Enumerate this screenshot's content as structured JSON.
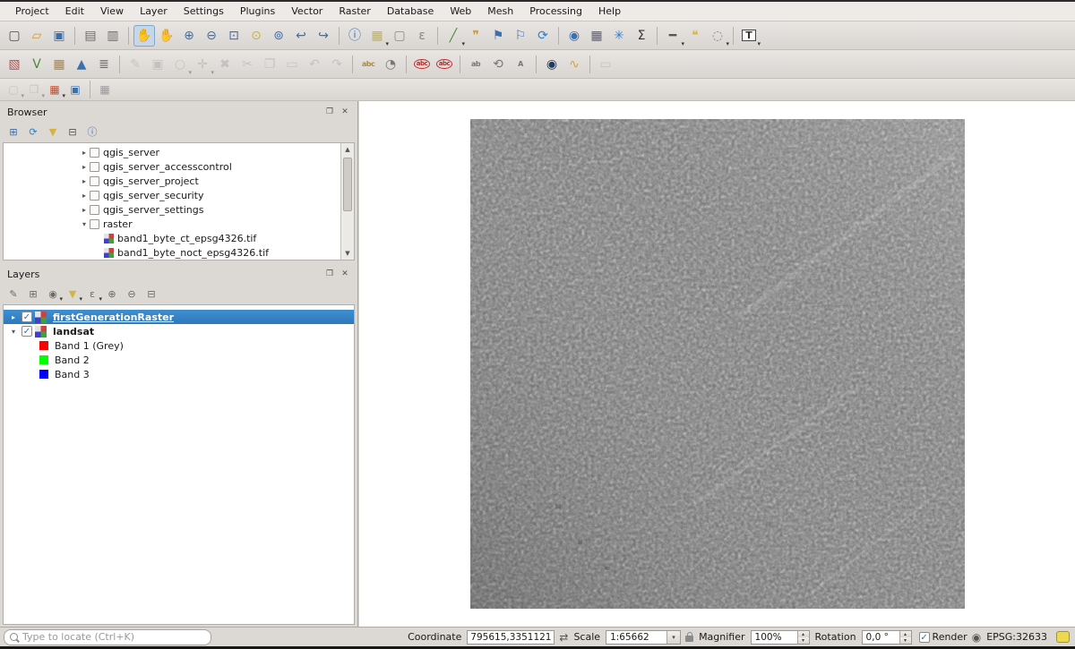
{
  "colors": {
    "selection_blue": "#2e78bc",
    "window_bg": "#dcd8d4",
    "canvas_bg": "#ffffff"
  },
  "menubar": {
    "items": [
      "Project",
      "Edit",
      "View",
      "Layer",
      "Settings",
      "Plugins",
      "Vector",
      "Raster",
      "Database",
      "Web",
      "Mesh",
      "Processing",
      "Help"
    ]
  },
  "toolbar_main": {
    "icons": [
      {
        "n": "new-project-icon",
        "g": "▢",
        "c": "#4a4a4a"
      },
      {
        "n": "open-project-icon",
        "g": "▱",
        "c": "#c79a3c"
      },
      {
        "n": "save-project-icon",
        "g": "▣",
        "c": "#3a6fb0"
      },
      {
        "sep": true
      },
      {
        "n": "new-print-layout-icon",
        "g": "▤",
        "c": "#6a6a6a"
      },
      {
        "n": "show-layout-manager-icon",
        "g": "▥",
        "c": "#6a6a6a"
      },
      {
        "sep": true
      },
      {
        "n": "pan-map-icon",
        "g": "✋",
        "c": "#b98c50",
        "active": true
      },
      {
        "n": "pan-to-selection-icon",
        "g": "✋",
        "c": "#d4b43c"
      },
      {
        "n": "zoom-in-icon",
        "g": "⊕",
        "c": "#3a6fb0"
      },
      {
        "n": "zoom-out-icon",
        "g": "⊖",
        "c": "#3a6fb0"
      },
      {
        "n": "zoom-full-icon",
        "g": "⊡",
        "c": "#3a6fb0"
      },
      {
        "n": "zoom-to-selection-icon",
        "g": "⊙",
        "c": "#c7b23c"
      },
      {
        "n": "zoom-to-layer-icon",
        "g": "⊚",
        "c": "#3a6fb0"
      },
      {
        "n": "zoom-last-icon",
        "g": "↩",
        "c": "#3a6fb0"
      },
      {
        "n": "zoom-next-icon",
        "g": "↪",
        "c": "#3a6fb0"
      },
      {
        "sep": true
      },
      {
        "n": "identify-features-icon",
        "g": "ⓘ",
        "c": "#3a6fb0"
      },
      {
        "n": "select-features-icon",
        "g": "▦",
        "c": "#c7b23c",
        "caret": true
      },
      {
        "n": "deselect-features-icon",
        "g": "▢",
        "c": "#888888"
      },
      {
        "n": "select-by-expression-icon",
        "g": "ε",
        "c": "#888888"
      },
      {
        "sep": true
      },
      {
        "n": "measure-icon",
        "g": "╱",
        "c": "#4a8a3a",
        "caret": true
      },
      {
        "n": "map-tips-icon",
        "g": "❞",
        "c": "#c79a3c"
      },
      {
        "n": "new-bookmark-icon",
        "g": "⚑",
        "c": "#3a6fb0"
      },
      {
        "n": "show-bookmarks-icon",
        "g": "⚐",
        "c": "#3a6fb0"
      },
      {
        "n": "refresh-map-icon",
        "g": "⟳",
        "c": "#2e7fd0"
      },
      {
        "sep": true
      },
      {
        "n": "zoom-native-resolution-icon",
        "g": "◉",
        "c": "#3a6fb0"
      },
      {
        "n": "open-attribute-table-icon",
        "g": "▦",
        "c": "#5a5a7a"
      },
      {
        "n": "processing-toolbox-icon",
        "g": "✳",
        "c": "#2e7fd0"
      },
      {
        "n": "statistics-summary-icon",
        "g": "Σ",
        "c": "#333333"
      },
      {
        "sep": true
      },
      {
        "n": "measure-line-icon",
        "g": "━",
        "c": "#555555",
        "caret": true
      },
      {
        "n": "text-annotation-icon",
        "g": "❝",
        "c": "#d4b43c"
      },
      {
        "n": "annotation-icon",
        "g": "◌",
        "c": "#888888",
        "caret": true
      },
      {
        "sep": true
      },
      {
        "n": "label-tool-icon",
        "g": "T",
        "c": "#333333",
        "boxed": true,
        "caret": true
      }
    ]
  },
  "toolbar_layers_add": {
    "icons": [
      {
        "n": "open-data-source-manager-icon",
        "g": "▧",
        "c": "#b05050"
      },
      {
        "n": "add-vector-layer-icon",
        "g": "V",
        "c": "#4a8a3a"
      },
      {
        "n": "add-raster-layer-icon",
        "g": "▦",
        "c": "#b0823c"
      },
      {
        "n": "add-mesh-layer-icon",
        "g": "▲",
        "c": "#3a6fb0"
      },
      {
        "n": "add-delimited-text-layer-icon",
        "g": "≣",
        "c": "#6a6a6a"
      },
      {
        "sep": true
      },
      {
        "n": "toggle-editing-icon",
        "g": "✎",
        "c": "#9a9a9a",
        "disabled": true
      },
      {
        "n": "save-layer-edits-icon",
        "g": "▣",
        "c": "#9a9a9a",
        "disabled": true
      },
      {
        "n": "add-feature-icon",
        "g": "○",
        "c": "#9a9a9a",
        "disabled": true,
        "caret": true
      },
      {
        "n": "vertex-tool-icon",
        "g": "✛",
        "c": "#9a9a9a",
        "disabled": true,
        "caret": true
      },
      {
        "n": "delete-selected-icon",
        "g": "✖",
        "c": "#9a9a9a",
        "disabled": true
      },
      {
        "n": "cut-features-icon",
        "g": "✂",
        "c": "#9a9a9a",
        "disabled": true
      },
      {
        "n": "copy-features-icon",
        "g": "❐",
        "c": "#9a9a9a",
        "disabled": true
      },
      {
        "n": "paste-features-icon",
        "g": "▭",
        "c": "#9a9a9a",
        "disabled": true
      },
      {
        "n": "undo-icon",
        "g": "↶",
        "c": "#9a9a9a",
        "disabled": true
      },
      {
        "n": "redo-icon",
        "g": "↷",
        "c": "#9a9a9a",
        "disabled": true
      },
      {
        "sep": true
      },
      {
        "n": "layer-labeling-icon",
        "g": "abc",
        "c": "#b08a3c",
        "text": true
      },
      {
        "n": "layer-diagram-icon",
        "g": "◔",
        "c": "#777777"
      },
      {
        "sep": true
      },
      {
        "n": "pin-labels-icon",
        "g": "abc",
        "c": "#b03030",
        "text": true,
        "ring": true
      },
      {
        "n": "highlight-pinned-labels-icon",
        "g": "abc",
        "c": "#b03030",
        "text": true,
        "ring": true
      },
      {
        "sep": true
      },
      {
        "n": "move-label-icon",
        "g": "ab",
        "c": "#777777",
        "text": true
      },
      {
        "n": "rotate-label-icon",
        "g": "⟲",
        "c": "#777777"
      },
      {
        "n": "change-label-icon",
        "g": "A",
        "c": "#777777",
        "text": true
      },
      {
        "sep": true
      },
      {
        "n": "metasearch-icon",
        "g": "◉",
        "c": "#223a5e"
      },
      {
        "n": "python-console-icon",
        "g": "∿",
        "c": "#d4a23c"
      },
      {
        "sep": true
      },
      {
        "n": "whats-this-icon",
        "g": "▭",
        "c": "#9a9a9a",
        "disabled": true
      }
    ]
  },
  "toolbar_edit_small": {
    "icons": [
      {
        "n": "select-tool-menu-icon",
        "g": "▢",
        "c": "#9a9a9a",
        "disabled": true,
        "caret": true
      },
      {
        "n": "clipboard-menu-icon",
        "g": "❐",
        "c": "#9a9a9a",
        "disabled": true,
        "caret": true
      },
      {
        "n": "advanced-digitizing-icon",
        "g": "▦",
        "c": "#c05030",
        "caret": true
      },
      {
        "n": "stream-digitizing-icon",
        "g": "▣",
        "c": "#3a6fb0"
      },
      {
        "sep": true
      },
      {
        "n": "temporal-controller-icon",
        "g": "▦",
        "c": "#9a9a9a"
      }
    ]
  },
  "panel_buttons": {
    "float": "❐",
    "close": "✕"
  },
  "browser": {
    "title": "Browser",
    "toolbar": [
      {
        "n": "add-selected-layers-icon",
        "g": "⊞",
        "c": "#3a6fb0"
      },
      {
        "n": "refresh-browser-icon",
        "g": "⟳",
        "c": "#2e7fd0"
      },
      {
        "n": "filter-browser-icon",
        "g": "▼",
        "c": "#d4b43c"
      },
      {
        "n": "collapse-all-icon",
        "g": "⊟",
        "c": "#555555"
      },
      {
        "n": "properties-widget-icon",
        "g": "ⓘ",
        "c": "#3a6fb0"
      }
    ],
    "items": [
      {
        "label": "qgis_server",
        "arrow": "▸",
        "icon": "folder",
        "indent": 0
      },
      {
        "label": "qgis_server_accesscontrol",
        "arrow": "▸",
        "icon": "folder",
        "indent": 0
      },
      {
        "label": "qgis_server_project",
        "arrow": "▸",
        "icon": "folder",
        "indent": 0
      },
      {
        "label": "qgis_server_security",
        "arrow": "▸",
        "icon": "folder",
        "indent": 0
      },
      {
        "label": "qgis_server_settings",
        "arrow": "▸",
        "icon": "folder",
        "indent": 0
      },
      {
        "label": "raster",
        "arrow": "▾",
        "icon": "folder",
        "indent": 0
      },
      {
        "label": "band1_byte_ct_epsg4326.tif",
        "icon": "raster",
        "indent": 1
      },
      {
        "label": "band1_byte_noct_epsg4326.tif",
        "icon": "raster",
        "indent": 1
      }
    ]
  },
  "layers": {
    "title": "Layers",
    "toolbar": [
      {
        "n": "open-layer-styling-icon",
        "g": "✎",
        "c": "#6a6a6a"
      },
      {
        "n": "add-group-icon",
        "g": "⊞",
        "c": "#6a6a6a"
      },
      {
        "n": "manage-map-themes-icon",
        "g": "◉",
        "c": "#6a6a6a",
        "caret": true
      },
      {
        "n": "filter-legend-icon",
        "g": "▼",
        "c": "#d4b43c",
        "caret": true
      },
      {
        "n": "filter-by-expression-icon",
        "g": "ε",
        "c": "#6a6a6a",
        "caret": true
      },
      {
        "n": "expand-all-icon",
        "g": "⊕",
        "c": "#6a6a6a"
      },
      {
        "n": "collapse-all-layers-icon",
        "g": "⊖",
        "c": "#6a6a6a"
      },
      {
        "n": "remove-layer-icon",
        "g": "⊟",
        "c": "#6a6a6a"
      }
    ],
    "items": [
      {
        "type": "layer",
        "label": "firstGenerationRaster",
        "selected": true,
        "checked": true,
        "arrow": "▸"
      },
      {
        "type": "layer",
        "label": "landsat",
        "checked": true,
        "arrow": "▾"
      },
      {
        "type": "band",
        "label": "Band 1 (Grey)",
        "swatch": "#ff0000"
      },
      {
        "type": "band",
        "label": "Band 2",
        "swatch": "#00ff00"
      },
      {
        "type": "band",
        "label": "Band 3",
        "swatch": "#0000ff"
      }
    ]
  },
  "statusbar": {
    "locate_placeholder": "Type to locate (Ctrl+K)",
    "coordinate_label": "Coordinate",
    "coordinate_value": "795615,3351121",
    "extents_glyph": "⇄",
    "scale_label": "Scale",
    "scale_value": "1:65662",
    "magnifier_label": "Magnifier",
    "magnifier_value": "100%",
    "rotation_label": "Rotation",
    "rotation_value": "0,0 °",
    "render_label": "Render",
    "crs_glyph": "◉",
    "crs_label": "EPSG:32633"
  }
}
